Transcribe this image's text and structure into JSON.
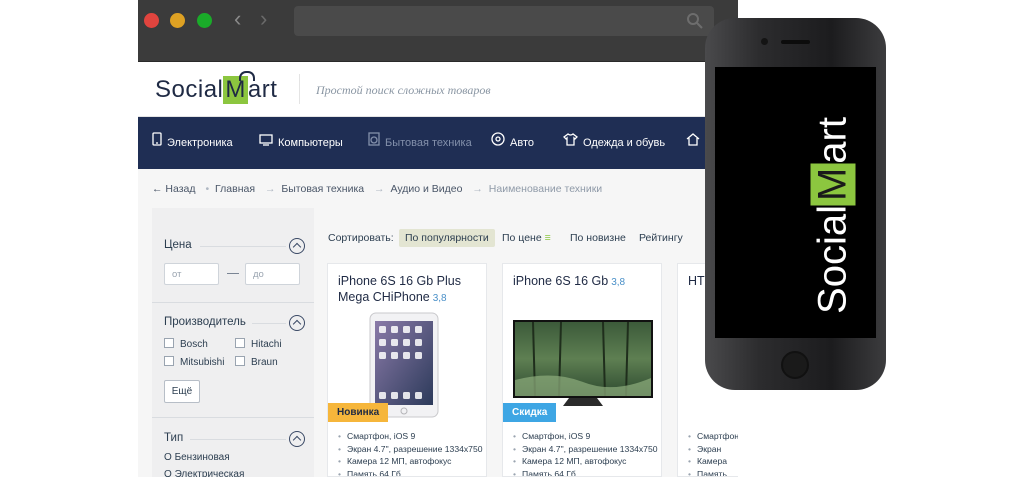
{
  "site": {
    "logo_pre": "Social",
    "logo_m": "M",
    "logo_post": "art",
    "tagline": "Простой поиск сложных товаров"
  },
  "categories": [
    {
      "label": "Электроника",
      "icon": "phone-icon"
    },
    {
      "label": "Компьютеры",
      "icon": "monitor-icon"
    },
    {
      "label": "Бытовая техника",
      "icon": "appliance-icon"
    },
    {
      "label": "Авто",
      "icon": "wheel-icon"
    },
    {
      "label": "Одежда и обувь",
      "icon": "shirt-icon"
    },
    {
      "label": "",
      "icon": "home-icon"
    }
  ],
  "breadcrumb": {
    "back": "← Назад",
    "items": [
      "Главная",
      "Бытовая техника",
      "Аудио и Видео"
    ],
    "current": "Наименование техники"
  },
  "filters": {
    "price_title": "Цена",
    "price_from_placeholder": "от",
    "price_to_placeholder": "до",
    "maker_title": "Производитель",
    "makers": [
      "Bosch",
      "Hitachi",
      "Mitsubishi",
      "Braun"
    ],
    "more_label": "Ещё",
    "type_title": "Тип",
    "types": [
      "Бензиновая",
      "Электрическая"
    ]
  },
  "sort": {
    "label": "Сортировать:",
    "options": [
      "По популярности",
      "По цене",
      "По новизне",
      "Рейтингу"
    ],
    "active": "По популярности"
  },
  "products": [
    {
      "title": "iPhone 6S 16 Gb Plus Mega CHiPhone",
      "rating": "3,8",
      "badge": "Новинка",
      "specs": [
        "Смартфон, iOS 9",
        "Экран 4.7\", разрешение 1334х750",
        "Камера 12 МП, автофокус",
        "Память 64 Гб"
      ]
    },
    {
      "title": "iPhone 6S 16 Gb",
      "rating": "3,8",
      "badge": "Скидка",
      "specs": [
        "Смартфон, iOS 9",
        "Экран 4.7\", разрешение 1334х750",
        "Камера 12 МП, автофокус",
        "Память 64 Гб"
      ]
    },
    {
      "title": "HTC",
      "rating": "",
      "badge": "",
      "specs": [
        "Смартфон",
        "Экран",
        "Камера",
        "Память"
      ]
    }
  ],
  "phone": {
    "logo_pre": "Social",
    "logo_m": "M",
    "logo_post": "art"
  },
  "colors": {
    "brand_green": "#8cc63f",
    "nav_bg": "#1f2e54",
    "badge_new": "#f6b63b",
    "badge_sale": "#3ea6e4"
  }
}
